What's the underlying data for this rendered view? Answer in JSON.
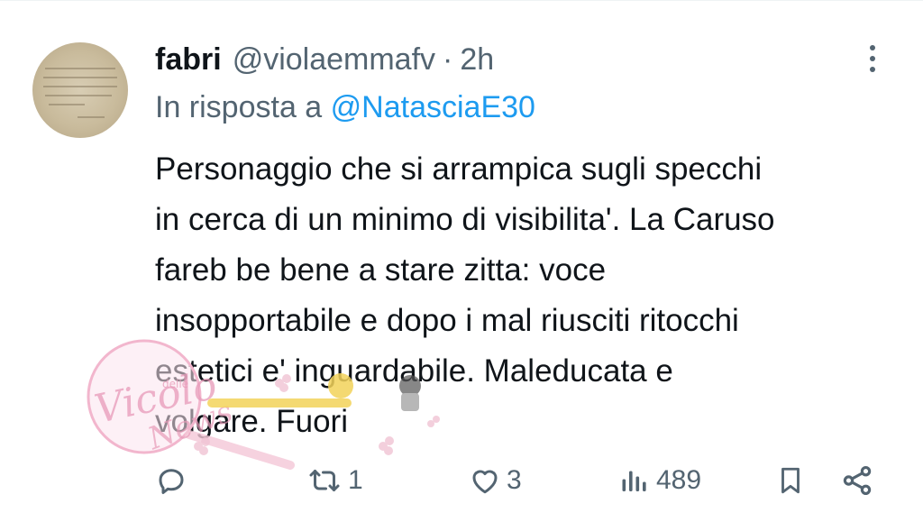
{
  "tweet": {
    "author_name": "fabri",
    "author_handle": "@violaemmafv",
    "separator": "·",
    "time": "2h",
    "reply_prefix": "In risposta a",
    "reply_mention": "@NatasciaE30",
    "text_lines": [
      "Personaggio che si arrampica sugli specchi",
      "in cerca di un minimo di visibilita'. La Caruso",
      "fareb be bene a stare zitta: voce",
      "insopportabile e dopo i mal riusciti ritocchi",
      "estetici e' inguardabile. Maleducata e",
      "volgare. Fuori"
    ]
  },
  "actions": {
    "reply_count": "",
    "retweet_count": "1",
    "like_count": "3",
    "views_count": "489"
  },
  "icons": {
    "reply": "reply-icon",
    "retweet": "retweet-icon",
    "like": "heart-icon",
    "views": "views-icon",
    "bookmark": "bookmark-icon",
    "share": "share-icon",
    "more": "more-vertical-icon"
  },
  "watermark": {
    "script_text": "Vicolo delle News"
  },
  "colors": {
    "text": "#0f1419",
    "secondary": "#536471",
    "link": "#1d9bf0"
  }
}
